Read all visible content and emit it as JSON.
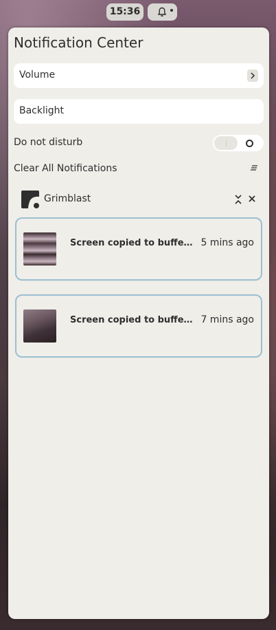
{
  "topbar": {
    "clock": "15:36",
    "bell_icon": "bell-icon"
  },
  "panel": {
    "title": "Notification Center",
    "volume_label": "Volume",
    "backlight_label": "Backlight",
    "dnd_label": "Do not disturb",
    "dnd_enabled": false,
    "clear_all_label": "Clear All Notifications"
  },
  "group": {
    "app_name": "Grimblast",
    "notifications": [
      {
        "summary": "Screen copied to buffer a...",
        "time": "5 mins ago"
      },
      {
        "summary": "Screen copied to buffer a...",
        "time": "7 mins ago"
      }
    ]
  },
  "colors": {
    "panel_bg": "#efeee9",
    "card_border": "#9bbfd0",
    "text": "#2e2e2e"
  }
}
